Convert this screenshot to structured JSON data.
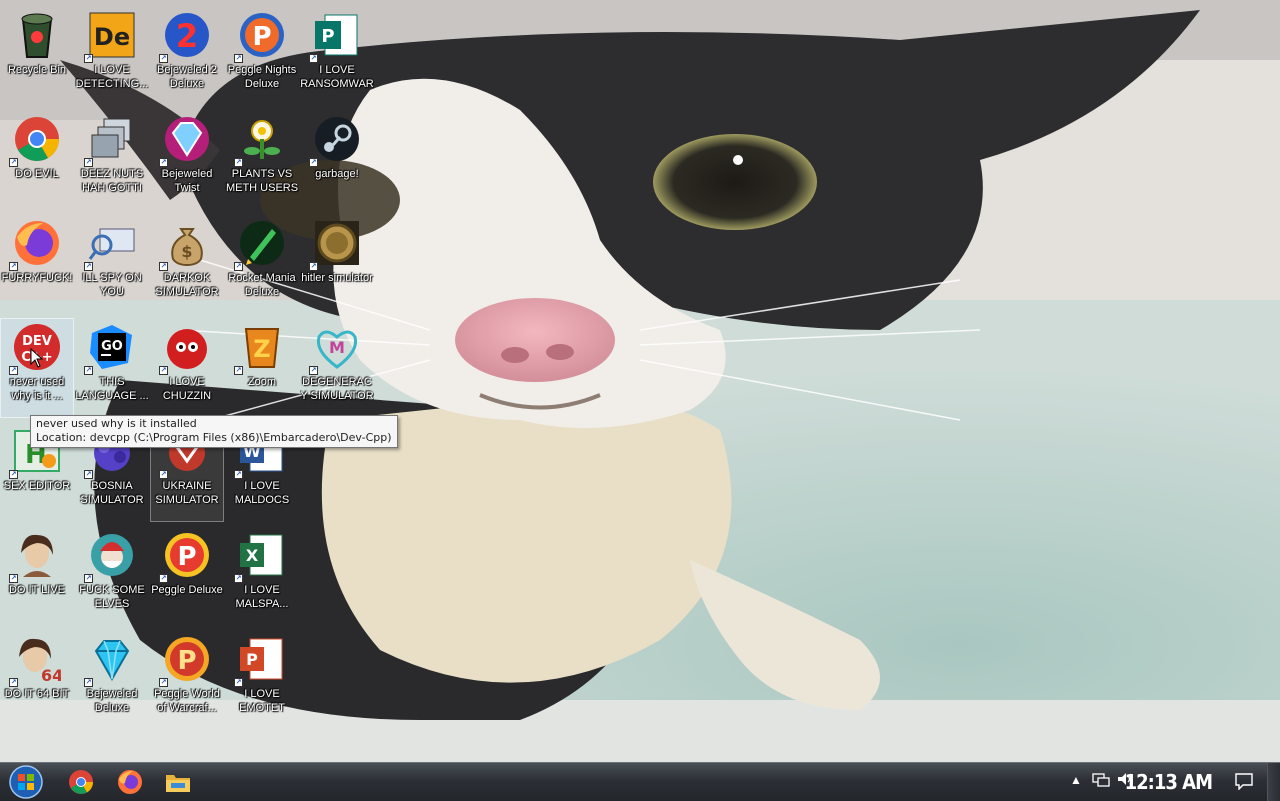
{
  "desktop": {
    "icons": [
      {
        "label": "Recycle Bin",
        "icon": "recycle-bin-icon"
      },
      {
        "label": "I LOVE DETECTING...",
        "icon": "detect-it-easy-icon"
      },
      {
        "label": "Bejeweled 2 Deluxe",
        "icon": "bejeweled-2-icon"
      },
      {
        "label": "Peggle Nights Deluxe",
        "icon": "peggle-nights-icon"
      },
      {
        "label": "I LOVE RANSOMWARE",
        "icon": "publisher-icon"
      },
      {
        "label": "DO EVIL",
        "icon": "chrome-icon"
      },
      {
        "label": "DEEZ NUTS HAH GOTTI",
        "icon": "stacked-windows-icon"
      },
      {
        "label": "Bejeweled Twist",
        "icon": "bejeweled-twist-icon"
      },
      {
        "label": "PLANTS VS METH USERS",
        "icon": "plants-vs-zombies-icon"
      },
      {
        "label": "garbage!",
        "icon": "steam-icon"
      },
      {
        "label": "FURRYFUCK!",
        "icon": "firefox-icon"
      },
      {
        "label": "ILL SPY ON YOU",
        "icon": "network-monitor-icon"
      },
      {
        "label": "DARKOK SIMULATOR",
        "icon": "money-bag-icon"
      },
      {
        "label": "Rocket Mania Deluxe",
        "icon": "rocket-mania-icon"
      },
      {
        "label": "hitler simulator",
        "icon": "coin-icon"
      },
      {
        "label": "never used why is it ...",
        "icon": "dev-cpp-icon"
      },
      {
        "label": "THIS LANGUAGE ...",
        "icon": "goland-icon"
      },
      {
        "label": "I LOVE CHUZZIN",
        "icon": "chuzzle-icon"
      },
      {
        "label": "Zoom",
        "icon": "zuma-icon"
      },
      {
        "label": "DEGENERACY SIMULATOR",
        "icon": "heart-m-icon"
      },
      {
        "label": "SEX EDITOR",
        "icon": "hex-editor-icon"
      },
      {
        "label": "BOSNIA SIMULATOR",
        "icon": "puzzle-icon"
      },
      {
        "label": "UKRAINE SIMULATOR",
        "icon": "red-game-icon"
      },
      {
        "label": "I LOVE MALDOCS",
        "icon": "word-icon"
      },
      {
        "label": "DO IT LIVE",
        "icon": "portrait-icon"
      },
      {
        "label": "FUCK SOME ELVES",
        "icon": "santa-globe-icon"
      },
      {
        "label": "Peggle Deluxe",
        "icon": "peggle-icon"
      },
      {
        "label": "I LOVE MALSPA...",
        "icon": "excel-icon"
      },
      {
        "label": "DO IT 64 BIT",
        "icon": "portrait-64-icon"
      },
      {
        "label": "Bejeweled Deluxe",
        "icon": "diamond-icon"
      },
      {
        "label": "Peggle World of Warcraf...",
        "icon": "peggle-wow-icon"
      },
      {
        "label": "I LOVE EMOTET",
        "icon": "powerpoint-icon"
      }
    ]
  },
  "tooltip": {
    "line1": "never used why is it installed",
    "line2": "Location: devcpp (C:\\Program Files (x86)\\Embarcadero\\Dev-Cpp)"
  },
  "taskbar": {
    "start": "start-orb-icon",
    "pinned": [
      "chrome-icon",
      "firefox-icon",
      "file-explorer-icon"
    ],
    "clock": "12:13 AM"
  },
  "colors": {
    "taskbar": "#2c3036",
    "tooltip_bg": "#f6f6f6",
    "label_text": "#ffffff"
  }
}
